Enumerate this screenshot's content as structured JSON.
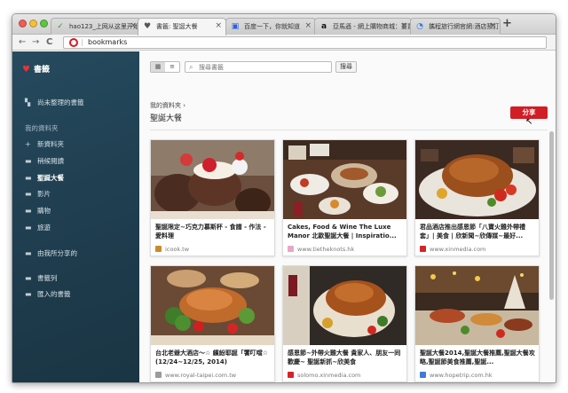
{
  "browser": {
    "tabs": [
      {
        "label": "hao123_上网从这里开始",
        "icon": "✓",
        "icon_name": "hao123-icon",
        "icon_color": "#3a9d23"
      },
      {
        "label": "書籤: 聖誕大餐",
        "icon": "♥",
        "icon_name": "heart-icon",
        "icon_color": "#555555"
      },
      {
        "label": "百度一下，你就知道",
        "icon": "▣",
        "icon_name": "baidu-icon",
        "icon_color": "#2b5fd9"
      },
      {
        "label": "亞馬遜 - 網上購物商城：要買...",
        "icon": "a",
        "icon_name": "amazon-icon",
        "icon_color": "#111111"
      },
      {
        "label": "攜程旅行網官網:酒店預訂,機...",
        "icon": "◔",
        "icon_name": "ctrip-icon",
        "icon_color": "#2577e3"
      }
    ],
    "tab_close": "×",
    "new_tab": "+",
    "nav": {
      "back": "←",
      "forward": "→",
      "reload": "C"
    },
    "address": "bookmarks"
  },
  "sidebar": {
    "header": "書籤",
    "unsorted": "尚未整理的書籤",
    "my_folders_label": "我的資料夾",
    "new_folder": "新資料夾",
    "folders": [
      "稍候閱讀",
      "聖誕大餐",
      "影片",
      "購物",
      "旅遊"
    ],
    "selected_folder": "聖誕大餐",
    "shared_by_you": "由我所分享的",
    "bookmark_bar": "書籤列",
    "imported": "匯入的書籤"
  },
  "main": {
    "view_grid_icon": "▦",
    "view_list_icon": "≡",
    "search_icon": "⌕",
    "search_placeholder": "搜尋書籤",
    "search_button": "搜尋",
    "breadcrumb": "我的資料夾  ›",
    "folder_title": "聖誕大餐",
    "share_button": "分享",
    "cursor": "↖"
  },
  "cards": [
    {
      "title": "聖誕限定~巧克力慕斯杯 - 食譜 - 作法 - 愛料理",
      "source": "icook.tw",
      "fav_color": "#c98a2b"
    },
    {
      "title": "Cakes, Food & Wine The Luxe Manor 北歐聖誕大餐 | Inspiratio...",
      "source": "www.tietheknots.hk",
      "fav_color": "#e8a6c6"
    },
    {
      "title": "君品酒店推出感恩節「八寶火雞外帶禮套」| 美食 | 欣新聞~欣傳媒~最好...",
      "source": "www.xinmedia.com",
      "fav_color": "#d6232a"
    },
    {
      "title": "台北老爺大酒店～☆ 繽紛耶誕「饗叮噹☆ (12/24~12/25, 2014)",
      "source": "www.royal-taipei.com.tw",
      "fav_color": "#9b9b9b"
    },
    {
      "title": "感恩節~外帶火雞大餐 貴家人、朋友一同歡慶~ 聖誕新抓~欣美食",
      "source": "solomo.xinmedia.com",
      "fav_color": "#d6232a"
    },
    {
      "title": "聖誕大餐2014,聖誕大餐推薦,聖誕大餐攻略,聖誕節美食推薦,聖誕...",
      "source": "www.hopetrip.com.hk",
      "fav_color": "#3d7bd8"
    }
  ]
}
